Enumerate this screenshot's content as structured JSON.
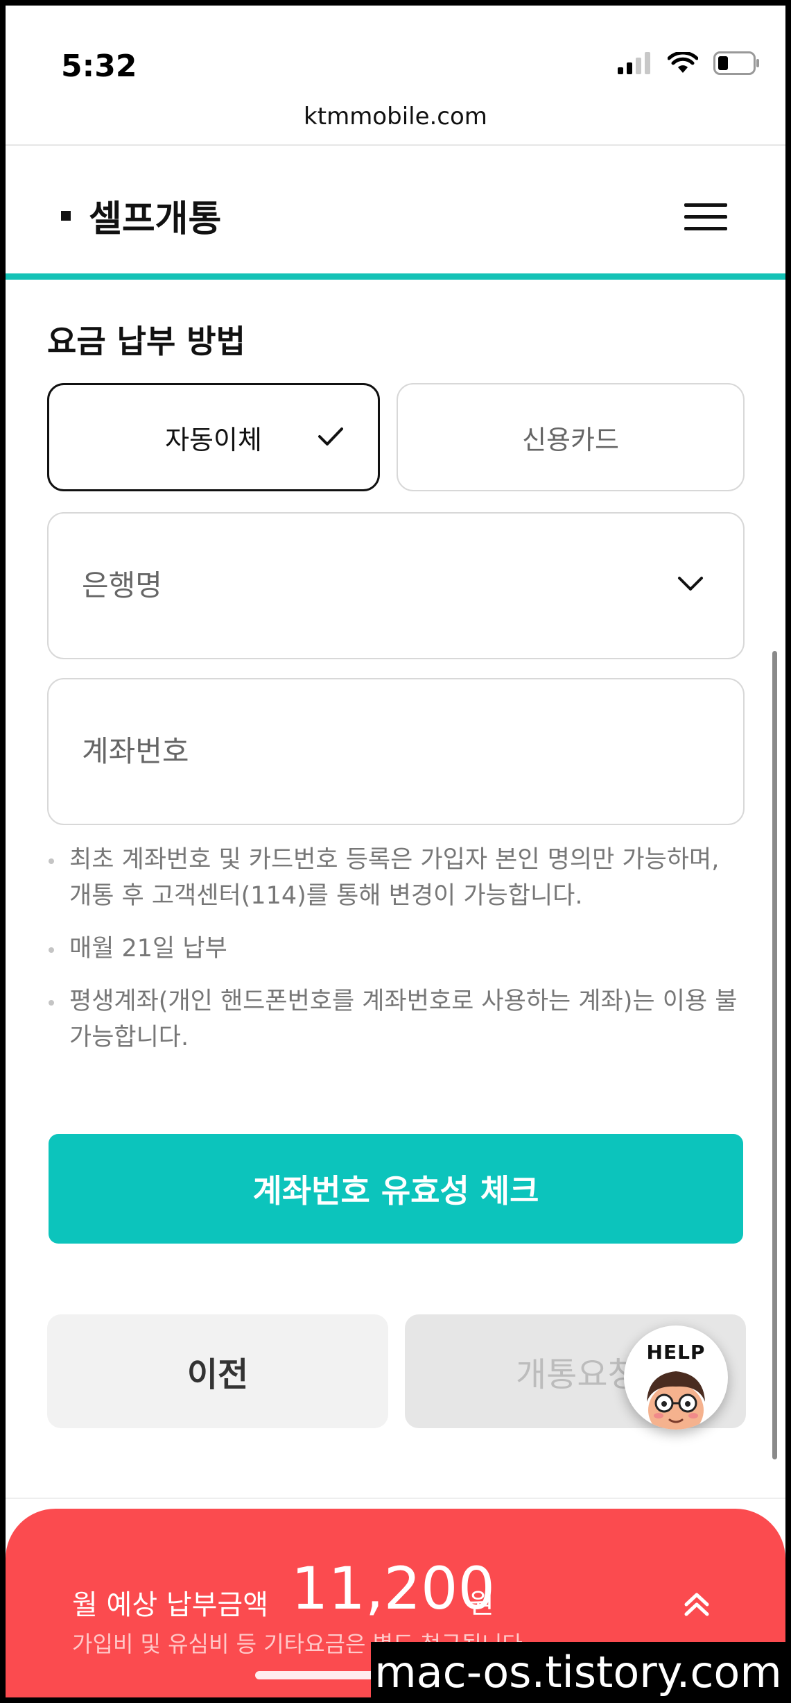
{
  "status_bar": {
    "time": "5:32",
    "icons": [
      "cellular-signal-icon",
      "wifi-icon",
      "battery-icon"
    ]
  },
  "browser": {
    "url": "ktmmobile.com"
  },
  "header": {
    "title": "셀프개통",
    "menu_icon": "hamburger-menu-icon"
  },
  "section": {
    "title": "요금 납부 방법"
  },
  "payment_methods": [
    {
      "label": "자동이체",
      "selected": true
    },
    {
      "label": "신용카드",
      "selected": false
    }
  ],
  "bank_select": {
    "placeholder": "은행명"
  },
  "account_input": {
    "placeholder": "계좌번호"
  },
  "notes": [
    "최초 계좌번호 및 카드번호 등록은 가입자 본인 명의만 가능하며, 개통 후 고객센터(114)를 통해 변경이 가능합니다.",
    "매월 21일 납부",
    "평생계좌(개인 핸드폰번호를 계좌번호로 사용하는 계좌)는 이용 불가능합니다."
  ],
  "buttons": {
    "validate": "계좌번호 유효성 체크",
    "prev": "이전",
    "open": "개통요청"
  },
  "help": {
    "label": "HELP"
  },
  "bottom_panel": {
    "label": "월 예상 납부금액",
    "amount": "11,200",
    "unit": "원",
    "note": "가입비 및 유심비 등 기타요금은 별도 청구됩니다."
  },
  "watermark": "mac-os.tistory.com",
  "colors": {
    "accent": "#0cc4bc",
    "panel": "#fb4b4f",
    "text": "#111111"
  }
}
